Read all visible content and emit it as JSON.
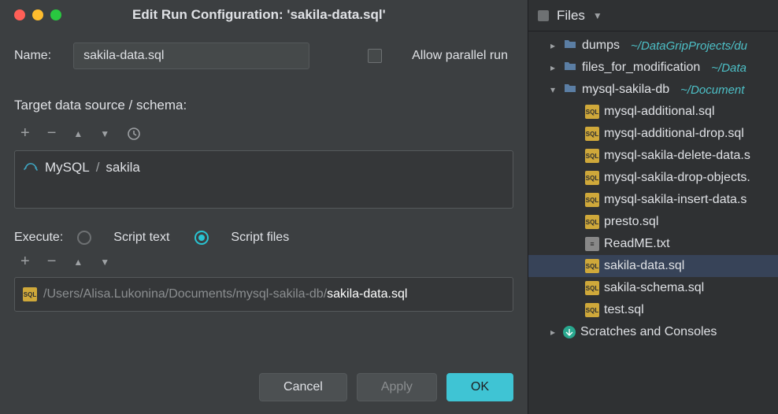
{
  "dialog": {
    "title": "Edit Run Configuration: 'sakila-data.sql'",
    "name_label": "Name:",
    "name_value": "sakila-data.sql",
    "allow_parallel_label": "Allow parallel run",
    "allow_parallel_checked": false,
    "target_label": "Target data source / schema:",
    "toolbar": {
      "add": "+",
      "remove": "−",
      "up": "▲",
      "down": "▼",
      "history_icon": "history-icon"
    },
    "datasource": {
      "icon": "mysql-icon",
      "db": "MySQL",
      "sep": "/",
      "schema": "sakila"
    },
    "execute_label": "Execute:",
    "radio_script_text": "Script text",
    "radio_script_files": "Script files",
    "execute_selected": "Script files",
    "files_toolbar": {
      "add": "+",
      "remove": "−",
      "up": "▲",
      "down": "▼"
    },
    "file_path_dir": "/Users/Alisa.Lukonina/Documents/mysql-sakila-db/",
    "file_path_file": "sakila-data.sql",
    "buttons": {
      "cancel": "Cancel",
      "apply": "Apply",
      "ok": "OK"
    }
  },
  "files_panel": {
    "title": "Files",
    "tree": [
      {
        "level": 1,
        "kind": "folder",
        "chev": "right",
        "name": "dumps",
        "suffix": "~/DataGripProjects/du"
      },
      {
        "level": 1,
        "kind": "folder",
        "chev": "right",
        "name": "files_for_modification",
        "suffix": "~/Data"
      },
      {
        "level": 1,
        "kind": "folder",
        "chev": "down",
        "name": "mysql-sakila-db",
        "suffix": "~/Document"
      },
      {
        "level": 2,
        "kind": "sql",
        "name": "mysql-additional.sql"
      },
      {
        "level": 2,
        "kind": "sql",
        "name": "mysql-additional-drop.sql"
      },
      {
        "level": 2,
        "kind": "sql",
        "name": "mysql-sakila-delete-data.s"
      },
      {
        "level": 2,
        "kind": "sql",
        "name": "mysql-sakila-drop-objects."
      },
      {
        "level": 2,
        "kind": "sql",
        "name": "mysql-sakila-insert-data.s"
      },
      {
        "level": 2,
        "kind": "sql",
        "name": "presto.sql"
      },
      {
        "level": 2,
        "kind": "txt",
        "name": "ReadME.txt"
      },
      {
        "level": 2,
        "kind": "sql",
        "name": "sakila-data.sql",
        "selected": true
      },
      {
        "level": 2,
        "kind": "sql",
        "name": "sakila-schema.sql"
      },
      {
        "level": 2,
        "kind": "sql",
        "name": "test.sql"
      },
      {
        "level": 1,
        "kind": "scratch",
        "chev": "right",
        "name": "Scratches and Consoles"
      }
    ]
  }
}
